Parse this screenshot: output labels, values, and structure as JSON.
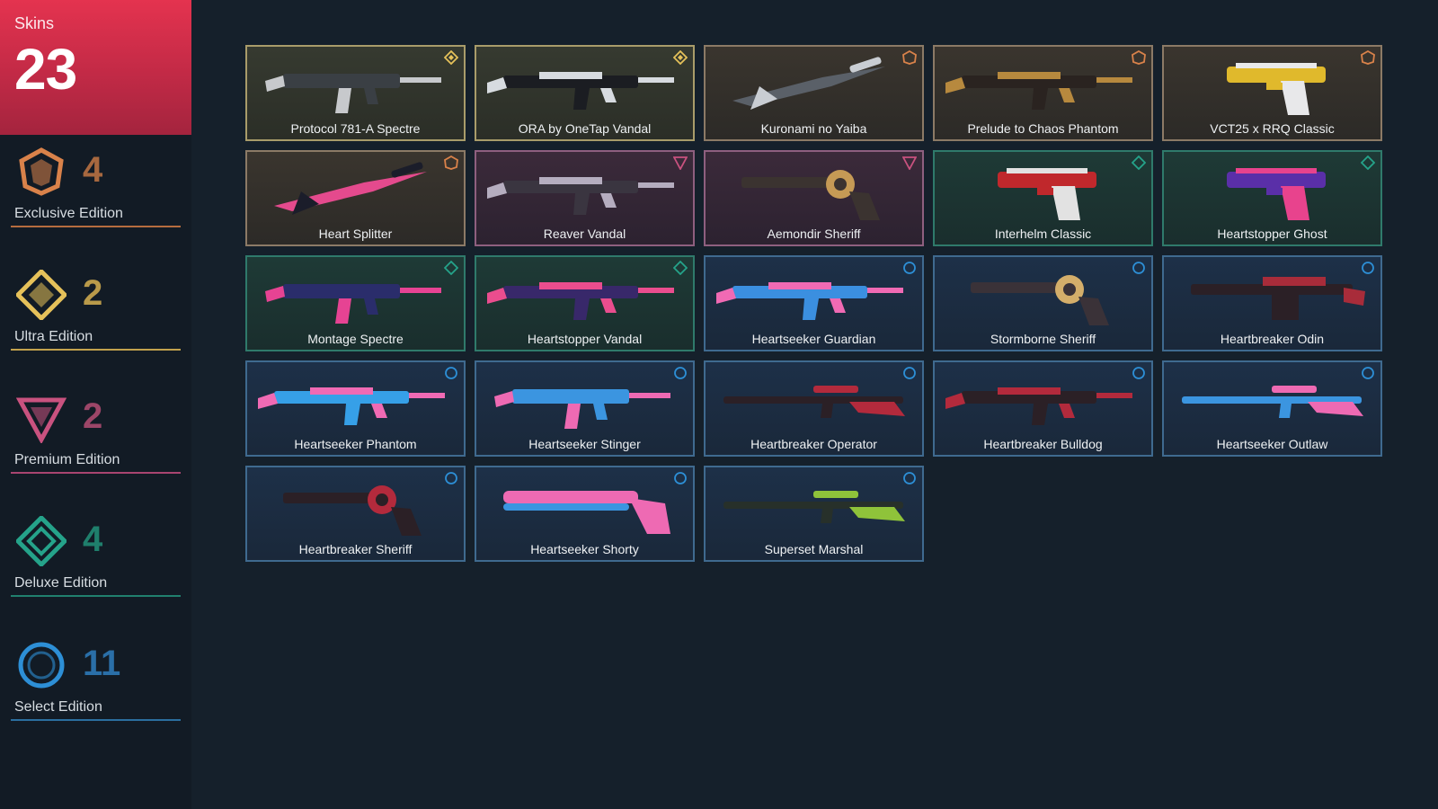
{
  "header": {
    "label": "Skins",
    "count": "23"
  },
  "editions": [
    {
      "name": "Exclusive Edition",
      "count": "4",
      "color": "#d9824a"
    },
    {
      "name": "Ultra Edition",
      "count": "2",
      "color": "#e5c15a"
    },
    {
      "name": "Premium Edition",
      "count": "2",
      "color": "#c9527f"
    },
    {
      "name": "Deluxe Edition",
      "count": "4",
      "color": "#25a38a"
    },
    {
      "name": "Select Edition",
      "count": "11",
      "color": "#2d8fd6"
    }
  ],
  "skins": [
    {
      "name": "Protocol 781-A Spectre",
      "tier": "ultra",
      "icon": "ultra-icon",
      "weapon": "smg",
      "colors": [
        "#3a3f44",
        "#c7c9cc"
      ]
    },
    {
      "name": "ORA by OneTap Vandal",
      "tier": "ultra",
      "icon": "ultra-icon",
      "weapon": "rifle",
      "colors": [
        "#1b1d22",
        "#d7dbe0"
      ]
    },
    {
      "name": "Kuronami no Yaiba",
      "tier": "exclusive",
      "icon": "exclusive-icon",
      "weapon": "knife",
      "colors": [
        "#c9cdd3",
        "#5a6068"
      ]
    },
    {
      "name": "Prelude to Chaos Phantom",
      "tier": "exclusive",
      "icon": "exclusive-icon",
      "weapon": "rifle",
      "colors": [
        "#2a2320",
        "#b7893e"
      ]
    },
    {
      "name": "VCT25 x RRQ Classic",
      "tier": "exclusive",
      "icon": "exclusive-icon",
      "weapon": "pistol",
      "colors": [
        "#e0b92c",
        "#e8e8ea"
      ]
    },
    {
      "name": "Heart Splitter",
      "tier": "exclusive",
      "icon": "exclusive-icon",
      "weapon": "knife",
      "colors": [
        "#1b1d2a",
        "#e44a8d"
      ]
    },
    {
      "name": "Reaver Vandal",
      "tier": "premium",
      "icon": "premium-icon",
      "weapon": "rifle",
      "colors": [
        "#3a3540",
        "#b5adbf"
      ]
    },
    {
      "name": "Aemondir Sheriff",
      "tier": "premium",
      "icon": "premium-icon",
      "weapon": "revolver",
      "colors": [
        "#3b3330",
        "#c59a55"
      ]
    },
    {
      "name": "Interhelm Classic",
      "tier": "deluxe",
      "icon": "deluxe-icon",
      "weapon": "pistol",
      "colors": [
        "#c0282c",
        "#e2e2e2"
      ]
    },
    {
      "name": "Heartstopper Ghost",
      "tier": "deluxe",
      "icon": "deluxe-icon",
      "weapon": "pistol",
      "colors": [
        "#5a2fa8",
        "#e8438d"
      ]
    },
    {
      "name": "Montage Spectre",
      "tier": "deluxe",
      "icon": "deluxe-icon",
      "weapon": "smg",
      "colors": [
        "#2a2d6b",
        "#e64393"
      ]
    },
    {
      "name": "Heartstopper Vandal",
      "tier": "deluxe",
      "icon": "deluxe-icon",
      "weapon": "rifle",
      "colors": [
        "#38286a",
        "#ea4d8e"
      ]
    },
    {
      "name": "Heartseeker Guardian",
      "tier": "select",
      "icon": "select-icon",
      "weapon": "rifle",
      "colors": [
        "#3b8fe0",
        "#f06ab4"
      ]
    },
    {
      "name": "Stormborne Sheriff",
      "tier": "select",
      "icon": "select-icon",
      "weapon": "revolver",
      "colors": [
        "#3a3238",
        "#d4ae6a"
      ]
    },
    {
      "name": "Heartbreaker Odin",
      "tier": "select",
      "icon": "select-icon",
      "weapon": "lmg",
      "colors": [
        "#2b2026",
        "#a82c3a"
      ]
    },
    {
      "name": "Heartseeker Phantom",
      "tier": "select",
      "icon": "select-icon",
      "weapon": "rifle",
      "colors": [
        "#36a0e8",
        "#f06ab4"
      ]
    },
    {
      "name": "Heartseeker Stinger",
      "tier": "select",
      "icon": "select-icon",
      "weapon": "smg",
      "colors": [
        "#3b95e0",
        "#ee6ab3"
      ]
    },
    {
      "name": "Heartbreaker Operator",
      "tier": "select",
      "icon": "select-icon",
      "weapon": "sniper",
      "colors": [
        "#2b2026",
        "#b32a3c"
      ]
    },
    {
      "name": "Heartbreaker Bulldog",
      "tier": "select",
      "icon": "select-icon",
      "weapon": "rifle",
      "colors": [
        "#2b2026",
        "#b32a3c"
      ]
    },
    {
      "name": "Heartseeker Outlaw",
      "tier": "select",
      "icon": "select-icon",
      "weapon": "sniper",
      "colors": [
        "#3b95e0",
        "#ee6ab3"
      ]
    },
    {
      "name": "Heartbreaker Sheriff",
      "tier": "select",
      "icon": "select-icon",
      "weapon": "revolver",
      "colors": [
        "#2b2026",
        "#b32a3c"
      ]
    },
    {
      "name": "Heartseeker Shorty",
      "tier": "select",
      "icon": "select-icon",
      "weapon": "shotgun",
      "colors": [
        "#3b95e0",
        "#ee6ab3"
      ]
    },
    {
      "name": "Superset Marshal",
      "tier": "select",
      "icon": "select-icon",
      "weapon": "sniper",
      "colors": [
        "#27302a",
        "#8fc33a"
      ]
    }
  ]
}
